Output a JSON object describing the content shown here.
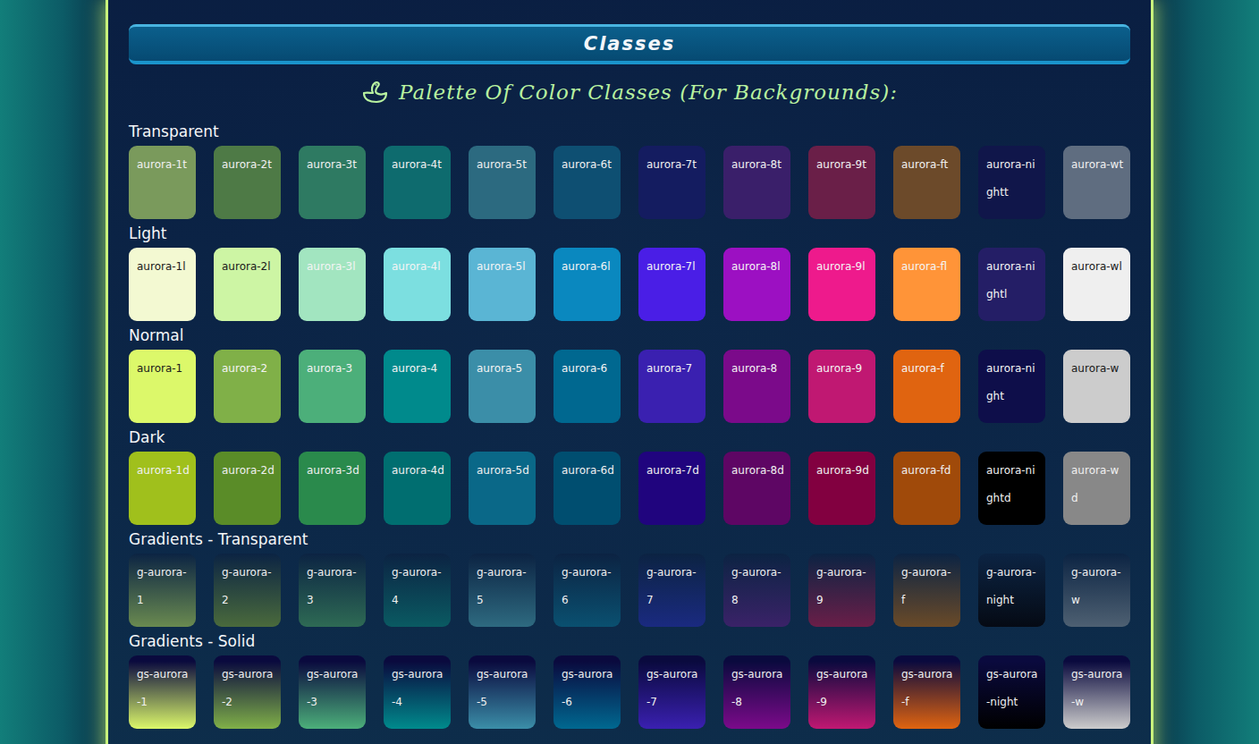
{
  "header": {
    "title": "Classes"
  },
  "subtitle": {
    "text": "Palette Of Color Classes (For Backgrounds):"
  },
  "sections": [
    {
      "label": "Transparent",
      "kind": "flat",
      "swatches": [
        {
          "name": "aurora-1t",
          "color": "#7a9a5c",
          "ink": "#f0f0f0"
        },
        {
          "name": "aurora-2t",
          "color": "#4e7a46",
          "ink": "#f0f0f0"
        },
        {
          "name": "aurora-3t",
          "color": "#2e7a62",
          "ink": "#f0f0f0"
        },
        {
          "name": "aurora-4t",
          "color": "#0e6b6e",
          "ink": "#f0f0f0"
        },
        {
          "name": "aurora-5t",
          "color": "#2c6a80",
          "ink": "#f0f0f0"
        },
        {
          "name": "aurora-6t",
          "color": "#0e4f72",
          "ink": "#f0f0f0"
        },
        {
          "name": "aurora-7t",
          "color": "#141c60",
          "ink": "#f0f0f0"
        },
        {
          "name": "aurora-8t",
          "color": "#3a1f6a",
          "ink": "#f0f0f0"
        },
        {
          "name": "aurora-9t",
          "color": "#6a1f48",
          "ink": "#f0f0f0"
        },
        {
          "name": "aurora-ft",
          "color": "#6c4a2a",
          "ink": "#f0f0f0"
        },
        {
          "name": "aurora-nightt",
          "color": "#10164a",
          "ink": "#f0f0f0"
        },
        {
          "name": "aurora-wt",
          "color": "#5f6d80",
          "ink": "#f0f0f0"
        }
      ]
    },
    {
      "label": "Light",
      "kind": "flat",
      "swatches": [
        {
          "name": "aurora-1l",
          "color": "#f3f9d2",
          "ink": "#1a1a1a"
        },
        {
          "name": "aurora-2l",
          "color": "#cdf5a4",
          "ink": "#1a1a1a"
        },
        {
          "name": "aurora-3l",
          "color": "#a2e5c0",
          "ink": "#f4f4f4"
        },
        {
          "name": "aurora-4l",
          "color": "#7cdfe0",
          "ink": "#f4f4f4"
        },
        {
          "name": "aurora-5l",
          "color": "#5ab5d4",
          "ink": "#f4f4f4"
        },
        {
          "name": "aurora-6l",
          "color": "#0a88bf",
          "ink": "#f4f4f4"
        },
        {
          "name": "aurora-7l",
          "color": "#4a1ee6",
          "ink": "#f4f4f4"
        },
        {
          "name": "aurora-8l",
          "color": "#9c10c2",
          "ink": "#f4f4f4"
        },
        {
          "name": "aurora-9l",
          "color": "#ee1a8c",
          "ink": "#f4f4f4"
        },
        {
          "name": "aurora-fl",
          "color": "#ff9438",
          "ink": "#f4f4f4"
        },
        {
          "name": "aurora-nightl",
          "color": "#241e66",
          "ink": "#f4f4f4"
        },
        {
          "name": "aurora-wl",
          "color": "#efefef",
          "ink": "#1a1a1a"
        }
      ]
    },
    {
      "label": "Normal",
      "kind": "flat",
      "swatches": [
        {
          "name": "aurora-1",
          "color": "#dcf86a",
          "ink": "#1a1a1a"
        },
        {
          "name": "aurora-2",
          "color": "#80b048",
          "ink": "#f4f4f4"
        },
        {
          "name": "aurora-3",
          "color": "#4caf7a",
          "ink": "#f4f4f4"
        },
        {
          "name": "aurora-4",
          "color": "#008a8c",
          "ink": "#f4f4f4"
        },
        {
          "name": "aurora-5",
          "color": "#3b8ea8",
          "ink": "#f4f4f4"
        },
        {
          "name": "aurora-6",
          "color": "#006890",
          "ink": "#f4f4f4"
        },
        {
          "name": "aurora-7",
          "color": "#3a20b0",
          "ink": "#f4f4f4"
        },
        {
          "name": "aurora-8",
          "color": "#7b0a8a",
          "ink": "#f4f4f4"
        },
        {
          "name": "aurora-9",
          "color": "#c01872",
          "ink": "#f4f4f4"
        },
        {
          "name": "aurora-f",
          "color": "#e06410",
          "ink": "#f4f4f4"
        },
        {
          "name": "aurora-night",
          "color": "#0e0e4a",
          "ink": "#f4f4f4"
        },
        {
          "name": "aurora-w",
          "color": "#cccccc",
          "ink": "#1a1a1a"
        }
      ]
    },
    {
      "label": "Dark",
      "kind": "flat",
      "swatches": [
        {
          "name": "aurora-1d",
          "color": "#a0c01c",
          "ink": "#f0f0f0"
        },
        {
          "name": "aurora-2d",
          "color": "#5a8c28",
          "ink": "#f0f0f0"
        },
        {
          "name": "aurora-3d",
          "color": "#2a8a4c",
          "ink": "#f0f0f0"
        },
        {
          "name": "aurora-4d",
          "color": "#006e70",
          "ink": "#f0f0f0"
        },
        {
          "name": "aurora-5d",
          "color": "#0a6888",
          "ink": "#f0f0f0"
        },
        {
          "name": "aurora-6d",
          "color": "#004e70",
          "ink": "#f0f0f0"
        },
        {
          "name": "aurora-7d",
          "color": "#20047e",
          "ink": "#f0f0f0"
        },
        {
          "name": "aurora-8d",
          "color": "#5e0664",
          "ink": "#f0f0f0"
        },
        {
          "name": "aurora-9d",
          "color": "#820040",
          "ink": "#f0f0f0"
        },
        {
          "name": "aurora-fd",
          "color": "#a04a0a",
          "ink": "#f0f0f0"
        },
        {
          "name": "aurora-nightd",
          "color": "#000000",
          "ink": "#f0f0f0"
        },
        {
          "name": "aurora-wd",
          "color": "#888888",
          "ink": "#f0f0f0"
        }
      ]
    },
    {
      "label": "Gradients - Transparent",
      "kind": "fade",
      "swatches": [
        {
          "name": "g-aurora-1",
          "color": "#6a8a50",
          "ink": "#f0f0f0"
        },
        {
          "name": "g-aurora-2",
          "color": "#4a6a3c",
          "ink": "#f0f0f0"
        },
        {
          "name": "g-aurora-3",
          "color": "#2e6a54",
          "ink": "#f0f0f0"
        },
        {
          "name": "g-aurora-4",
          "color": "#0a5a62",
          "ink": "#f0f0f0"
        },
        {
          "name": "g-aurora-5",
          "color": "#2e6a80",
          "ink": "#f0f0f0"
        },
        {
          "name": "g-aurora-6",
          "color": "#0a5070",
          "ink": "#f0f0f0"
        },
        {
          "name": "g-aurora-7",
          "color": "#1a2a80",
          "ink": "#f0f0f0"
        },
        {
          "name": "g-aurora-8",
          "color": "#3a2268",
          "ink": "#f0f0f0"
        },
        {
          "name": "g-aurora-9",
          "color": "#6a1e48",
          "ink": "#f0f0f0"
        },
        {
          "name": "g-aurora-f",
          "color": "#6a4a28",
          "ink": "#f0f0f0"
        },
        {
          "name": "g-aurora-night",
          "color": "#050a14",
          "ink": "#f0f0f0"
        },
        {
          "name": "g-aurora-w",
          "color": "#4e6072",
          "ink": "#f0f0f0"
        }
      ]
    },
    {
      "label": "Gradients - Solid",
      "kind": "blend",
      "swatches": [
        {
          "name": "gs-aurora-1",
          "color": "#dcf86a",
          "ink": "#f0f0f0"
        },
        {
          "name": "gs-aurora-2",
          "color": "#80b048",
          "ink": "#f0f0f0"
        },
        {
          "name": "gs-aurora-3",
          "color": "#4caf7a",
          "ink": "#f0f0f0"
        },
        {
          "name": "gs-aurora-4",
          "color": "#008a8c",
          "ink": "#f0f0f0"
        },
        {
          "name": "gs-aurora-5",
          "color": "#3b8ea8",
          "ink": "#f0f0f0"
        },
        {
          "name": "gs-aurora-6",
          "color": "#006890",
          "ink": "#f0f0f0"
        },
        {
          "name": "gs-aurora-7",
          "color": "#3a20b0",
          "ink": "#f0f0f0"
        },
        {
          "name": "gs-aurora-8",
          "color": "#7b0a8a",
          "ink": "#f0f0f0"
        },
        {
          "name": "gs-aurora-9",
          "color": "#c01872",
          "ink": "#f0f0f0"
        },
        {
          "name": "gs-aurora-f",
          "color": "#e06410",
          "ink": "#f0f0f0"
        },
        {
          "name": "gs-aurora-night",
          "color": "#000000",
          "ink": "#f0f0f0"
        },
        {
          "name": "gs-aurora-w",
          "color": "#cccccc",
          "ink": "#f0f0f0"
        }
      ]
    }
  ]
}
